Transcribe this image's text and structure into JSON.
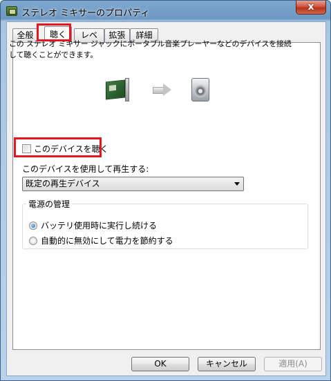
{
  "window": {
    "title": "ステレオ ミキサーのプロパティ",
    "close_label": "x"
  },
  "tabs": [
    {
      "label": "全般"
    },
    {
      "label": "聴く"
    },
    {
      "label": "レベル"
    },
    {
      "label": "拡張"
    },
    {
      "label": "詳細"
    }
  ],
  "active_tab": "聴く",
  "description": "この ステレオ ミキサー ジャックにポータブル音楽プレーヤーなどのデバイスを接続して聴くことができます。",
  "icons": {
    "source": "sound-card-icon",
    "arrow": "arrow-right-icon",
    "target": "speaker-icon"
  },
  "listen_checkbox": {
    "label": "このデバイスを聴く",
    "checked": false
  },
  "playback": {
    "label": "このデバイスを使用して再生する:",
    "selected": "既定の再生デバイス"
  },
  "power": {
    "title": "電源の管理",
    "options": [
      {
        "label": "バッテリ使用時に実行し続ける",
        "checked": true
      },
      {
        "label": "自動的に無効にして電力を節約する",
        "checked": false
      }
    ]
  },
  "buttons": {
    "ok": "OK",
    "cancel": "キャンセル",
    "apply": "適用(A)"
  },
  "colors": {
    "highlight": "#e8141f",
    "close_button": "#c8442c"
  }
}
